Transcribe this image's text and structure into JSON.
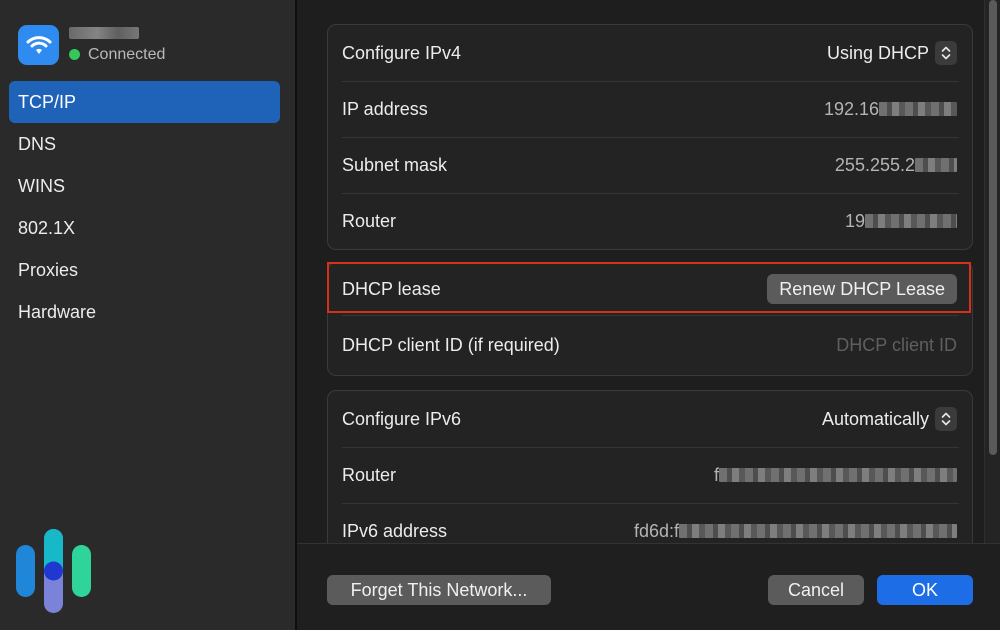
{
  "network": {
    "name_redacted": true,
    "status": "Connected",
    "status_color": "#34c759",
    "icon": "wifi-icon"
  },
  "sidebar": {
    "items": [
      {
        "label": "TCP/IP",
        "active": true
      },
      {
        "label": "DNS",
        "active": false
      },
      {
        "label": "WINS",
        "active": false
      },
      {
        "label": "802.1X",
        "active": false
      },
      {
        "label": "Proxies",
        "active": false
      },
      {
        "label": "Hardware",
        "active": false
      }
    ]
  },
  "ipv4": {
    "configure_label": "Configure IPv4",
    "configure_value": "Using DHCP",
    "ip_label": "IP address",
    "ip_value": "192.16",
    "subnet_label": "Subnet mask",
    "subnet_value": "255.255.2",
    "router_label": "Router",
    "router_value": "19"
  },
  "dhcp": {
    "lease_label": "DHCP lease",
    "renew_button": "Renew DHCP Lease",
    "client_id_label": "DHCP client ID (if required)",
    "client_id_placeholder": "DHCP client ID"
  },
  "ipv6": {
    "configure_label": "Configure IPv6",
    "configure_value": "Automatically",
    "router_label": "Router",
    "router_value": "f",
    "address_label": "IPv6 address",
    "address_value": "fd6d:f"
  },
  "footer": {
    "forget_button": "Forget This Network...",
    "cancel_button": "Cancel",
    "ok_button": "OK"
  },
  "colors": {
    "accent": "#1d6ee6",
    "sidebar_selected": "#1f63b8",
    "highlight_border": "#d4311c"
  }
}
